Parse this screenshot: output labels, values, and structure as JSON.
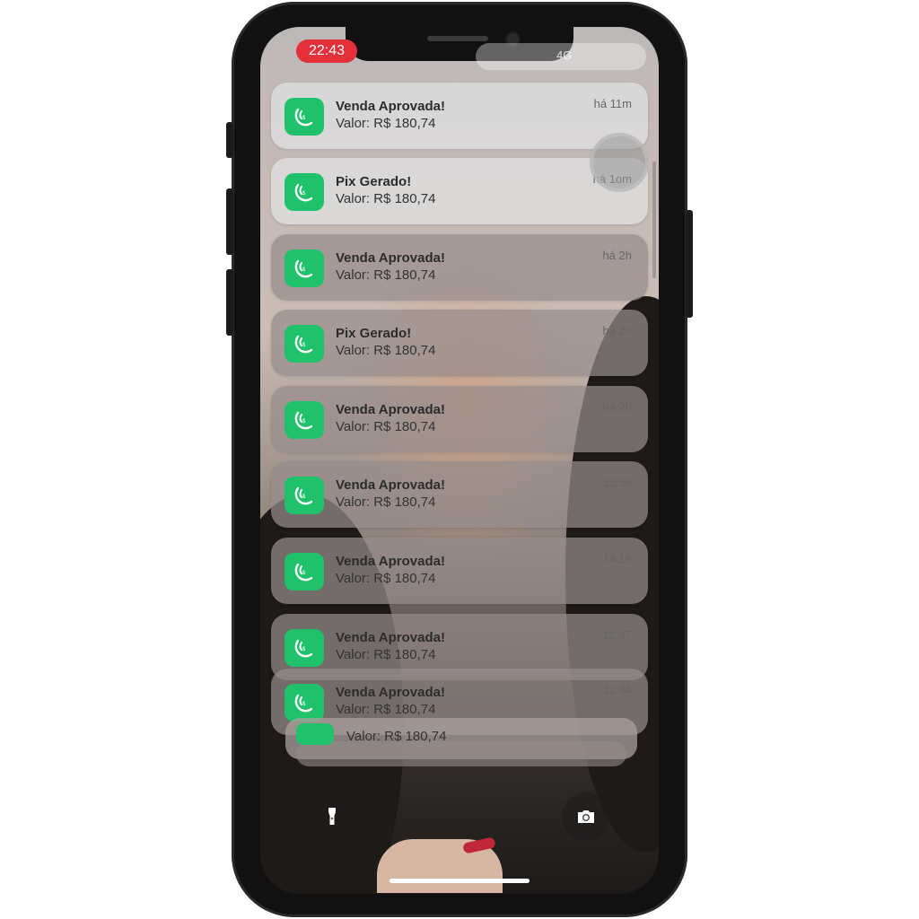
{
  "status_bar": {
    "time": "22:43",
    "signal": "4G"
  },
  "notifications": [
    {
      "title": "Venda Aprovada!",
      "value": "Valor: R$ 180,74",
      "time": "há 11m"
    },
    {
      "title": "Pix Gerado!",
      "value": "Valor: R$ 180,74",
      "time": "há 1om"
    },
    {
      "title": "Venda Aprovada!",
      "value": "Valor: R$ 180,74",
      "time": "há 2h"
    },
    {
      "title": "Pix Gerado!",
      "value": "Valor: R$ 180,74",
      "time": "há 2h"
    },
    {
      "title": "Venda Aprovada!",
      "value": "Valor: R$ 180,74",
      "time": "há 2h"
    },
    {
      "title": "Venda Aprovada!",
      "value": "Valor: R$ 180,74",
      "time": "15:59"
    },
    {
      "title": "Venda Aprovada!",
      "value": "Valor: R$ 180,74",
      "time": "14:16"
    },
    {
      "title": "Venda Aprovada!",
      "value": "Valor: R$ 180,74",
      "time": "12:37"
    },
    {
      "title": "Venda Aprovada!",
      "value": "Valor: R$ 180,74",
      "time": "11:44"
    }
  ],
  "stacked_notification": {
    "value": "Valor: R$ 180,74"
  },
  "lockscreen": {
    "flashlight_icon": "flashlight-icon",
    "camera_icon": "camera-icon"
  },
  "colors": {
    "app_icon": "#1fc16b",
    "status_time_bg": "#e3303a"
  }
}
